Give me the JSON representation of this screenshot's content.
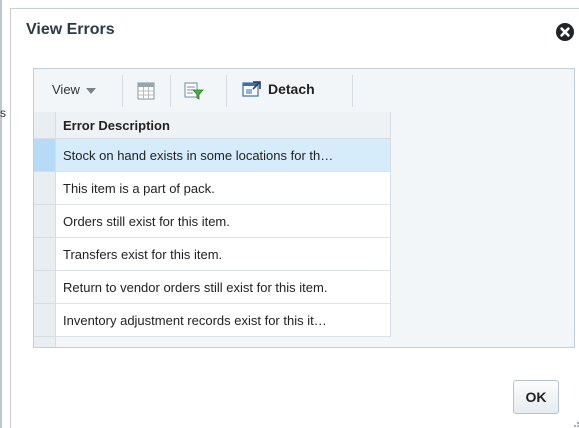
{
  "dialog": {
    "title": "View Errors",
    "close_icon": "close-circle-icon"
  },
  "toolbar": {
    "view_label": "View",
    "view_caret_icon": "caret-down-icon",
    "freeze_icon": "freeze-columns-icon",
    "filter_icon": "query-by-example-icon",
    "detach_icon": "detach-icon",
    "detach_label": "Detach"
  },
  "table": {
    "column_header": "Error Description",
    "rows": [
      {
        "text": "Stock on hand exists in some locations for th…",
        "selected": true
      },
      {
        "text": "This item is a part of pack.",
        "selected": false
      },
      {
        "text": "Orders still exist for this item.",
        "selected": false
      },
      {
        "text": "Transfers exist for this item.",
        "selected": false
      },
      {
        "text": "Return to vendor orders still exist for this item.",
        "selected": false
      },
      {
        "text": "Inventory adjustment records exist for this it…",
        "selected": false
      }
    ]
  },
  "footer": {
    "ok_label": "OK",
    "resize_icon": "resize-grip-icon"
  },
  "background": {
    "fragment_1": "s",
    "colors": {
      "selected_row": "#d6ecfb",
      "selected_gutter": "#b7dbf6",
      "panel": "#f3f6f9",
      "close_button": "#1f2428"
    }
  }
}
